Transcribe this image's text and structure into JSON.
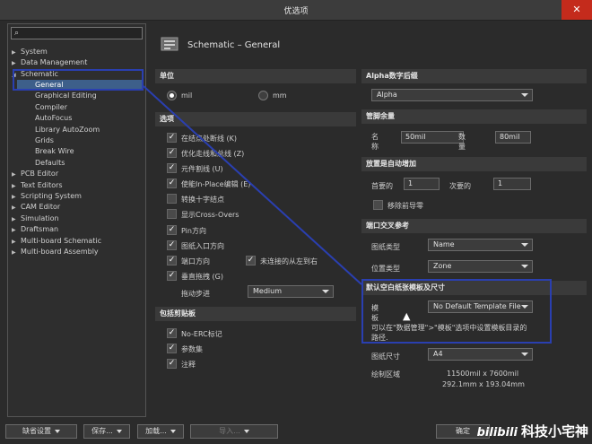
{
  "window": {
    "title": "优选项",
    "close_glyph": "✕"
  },
  "tree": {
    "search_icon": "search-icon",
    "items": [
      {
        "label": "System",
        "arrow": "▶"
      },
      {
        "label": "Data Management",
        "arrow": "▶"
      },
      {
        "label": "Schematic",
        "arrow": "◢"
      },
      {
        "label": "General",
        "selected": true
      },
      {
        "label": "Graphical Editing"
      },
      {
        "label": "Compiler"
      },
      {
        "label": "AutoFocus"
      },
      {
        "label": "Library AutoZoom"
      },
      {
        "label": "Grids"
      },
      {
        "label": "Break Wire"
      },
      {
        "label": "Defaults"
      },
      {
        "label": "PCB Editor",
        "arrow": "▶"
      },
      {
        "label": "Text Editors",
        "arrow": "▶"
      },
      {
        "label": "Scripting System",
        "arrow": "▶"
      },
      {
        "label": "CAM Editor",
        "arrow": "▶"
      },
      {
        "label": "Simulation",
        "arrow": "▶"
      },
      {
        "label": "Draftsman",
        "arrow": "▶"
      },
      {
        "label": "Multi-board Schematic",
        "arrow": "▶"
      },
      {
        "label": "Multi-board Assembly",
        "arrow": "▶"
      }
    ]
  },
  "main": {
    "title": "Schematic – General",
    "units": {
      "heading": "单位",
      "mil": "mil",
      "mm": "mm",
      "selected": "mil"
    },
    "options": {
      "heading": "选项",
      "items": [
        {
          "label": "在结点处断线 (K)",
          "checked": true
        },
        {
          "label": "优化走线和总线 (Z)",
          "checked": true
        },
        {
          "label": "元件割线 (U)",
          "checked": true
        },
        {
          "label": "使能In-Place编辑 (E)",
          "checked": true
        },
        {
          "label": "转换十字结点",
          "checked": false
        },
        {
          "label": "显示Cross-Overs",
          "checked": false
        },
        {
          "label": "Pin方向",
          "checked": true
        },
        {
          "label": "图纸入口方向",
          "checked": true
        },
        {
          "label": "端口方向",
          "checked": true
        },
        {
          "label": "垂直拖拽 (G)",
          "checked": true
        }
      ],
      "unconnected_left_to_right": {
        "label": "未连接的从左到右",
        "checked": true
      },
      "drag_step": {
        "label": "拖动步进",
        "value": "Medium"
      }
    },
    "clipboard": {
      "heading": "包括剪贴板",
      "items": [
        {
          "label": "No-ERC标记",
          "checked": true
        },
        {
          "label": "参数集",
          "checked": true
        },
        {
          "label": "注释",
          "checked": true
        }
      ]
    },
    "alpha": {
      "heading": "Alpha数字后缀",
      "value": "Alpha"
    },
    "pin_margin": {
      "heading": "管脚余量",
      "name_label": "名称",
      "name_value": "50mil",
      "number_label": "数量",
      "number_value": "80mil"
    },
    "auto_increment": {
      "heading": "放置是自动增加",
      "primary_label": "首要的",
      "primary_value": "1",
      "secondary_label": "次要的",
      "secondary_value": "1",
      "remove_leading_zeros": {
        "label": "移除前导零",
        "checked": false
      }
    },
    "port_cross_ref": {
      "heading": "端口交叉参考",
      "sheet_type_label": "图纸类型",
      "sheet_type_value": "Name",
      "location_type_label": "位置类型",
      "location_type_value": "Zone"
    },
    "default_template": {
      "heading": "默认空白纸张模板及尺寸",
      "template_label": "模板",
      "template_value": "No Default Template File",
      "note": "可以在\"数据管理\">\"模板\"选项中设置模板目录的路径.",
      "sheet_size_label": "图纸尺寸",
      "sheet_size_value": "A4",
      "drawing_area_label": "绘制区域",
      "drawing_area_mil": "11500mil x 7600mil",
      "drawing_area_mm": "292.1mm x 193.04mm"
    }
  },
  "bottom": {
    "default_btn": "缺省设置",
    "save_btn": "保存...",
    "load_btn": "加载...",
    "import_btn": "导入...",
    "confirm_btn": "确定"
  },
  "watermark": {
    "brand": "bilibili",
    "text": "科技小宅神"
  },
  "colors": {
    "highlight": "#2a3fb0",
    "selection": "#3d5f8a",
    "close": "#c42b1c"
  }
}
